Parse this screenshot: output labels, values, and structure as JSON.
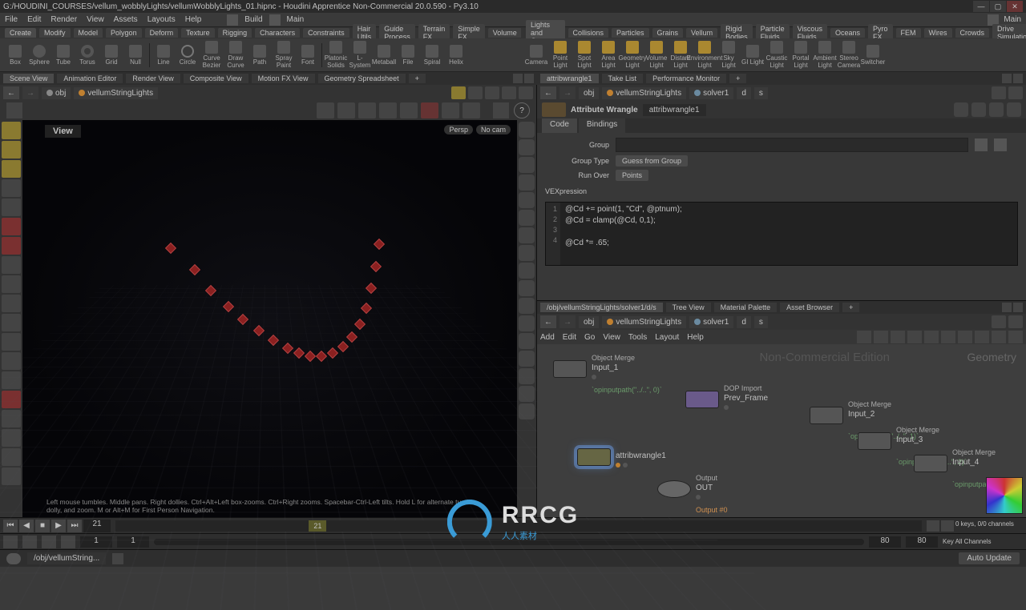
{
  "title": "G:/HOUDINI_COURSES/vellum_wobblyLights/vellumWobblyLights_01.hipnc - Houdini Apprentice Non-Commercial 20.0.590 - Py3.10",
  "menubar": [
    "File",
    "Edit",
    "Render",
    "View",
    "Assets",
    "Layouts",
    "Help"
  ],
  "config_build": "Build",
  "config_main_left": "Main",
  "config_main_right": "Main",
  "shelf": {
    "left_tab": "Create",
    "groups_left": [
      "Create",
      "Modify",
      "Model",
      "Polygon",
      "Deform",
      "Texture",
      "Rigging",
      "Characters",
      "Constraints",
      "Hair Utils",
      "Guide Process",
      "Terrain FX",
      "Simple FX",
      "Volume"
    ],
    "tools_left": [
      "Box",
      "Sphere",
      "Tube",
      "Torus",
      "Grid",
      "Null",
      "Line",
      "Circle",
      "Curve Bezier",
      "Draw Curve",
      "Path",
      "Spray Paint",
      "Font",
      "Platonic Solids",
      "L-System",
      "Metaball",
      "File",
      "Spiral",
      "Helix"
    ],
    "groups_right": [
      "Lights and Cameras",
      "Collisions",
      "Particles",
      "Grains",
      "Vellum",
      "Rigid Bodies",
      "Particle Fluids",
      "Viscous Fluids",
      "Oceans",
      "Pyro FX",
      "FEM",
      "Wires",
      "Crowds",
      "Drive Simulation"
    ],
    "tools_right": [
      "Camera",
      "Point Light",
      "Spot Light",
      "Area Light",
      "Geometry Light",
      "Volume Light",
      "Distant Light",
      "Environment Light",
      "Sky Light",
      "GI Light",
      "Caustic Light",
      "Portal Light",
      "Ambient Light",
      "Stereo Camera",
      "Switcher"
    ]
  },
  "panetabs_left": [
    "Scene View",
    "Animation Editor",
    "Render View",
    "Composite View",
    "Motion FX View",
    "Geometry Spreadsheet"
  ],
  "panetabs_right_top": [
    "attribwrangle1",
    "Take List",
    "Performance Monitor"
  ],
  "panetabs_right_bottom": [
    "/obj/vellumStringLights/solver1/d/s",
    "Tree View",
    "Material Palette",
    "Asset Browser"
  ],
  "path_left": {
    "obj": "obj",
    "geo": "vellumStringLights"
  },
  "path_right": {
    "obj": "obj",
    "geo": "vellumStringLights",
    "sop": "solver1",
    "d": "d",
    "s": "s"
  },
  "viewport": {
    "label": "View",
    "persp": "Persp",
    "cam": "No cam",
    "hint": "Left mouse tumbles. Middle pans. Right dollies. Ctrl+Alt+Left box-zooms. Ctrl+Right zooms. Spacebar-Ctrl-Left tilts. Hold L for alternate tumble, dolly, and zoom. M or Alt+M for First Person Navigation."
  },
  "parm": {
    "type": "Attribute Wrangle",
    "name": "attribwrangle1",
    "tabs": [
      "Code",
      "Bindings"
    ],
    "group_label": "Group",
    "group_value": "",
    "group_type_label": "Group Type",
    "group_type_value": "Guess from Group",
    "run_over_label": "Run Over",
    "run_over_value": "Points",
    "vex_label": "VEXpression",
    "vex_lines": [
      "@Cd += point(1, \"Cd\", @ptnum);",
      "@Cd = clamp(@Cd, 0,1);",
      "",
      "@Cd *= .65;"
    ]
  },
  "netmenu": [
    "Add",
    "Edit",
    "Go",
    "View",
    "Tools",
    "Layout",
    "Help"
  ],
  "net_watermark": "Non-Commercial Edition",
  "net_context": "Geometry",
  "nodes": {
    "input1": {
      "type": "Object Merge",
      "name": "Input_1",
      "expr": "`opinputpath(\"../..\", 0)`"
    },
    "prev": {
      "type": "DOP Import",
      "name": "Prev_Frame"
    },
    "wrangle": {
      "name": "attribwrangle1"
    },
    "out": {
      "type": "Output",
      "name": "OUT",
      "out": "Output #0"
    },
    "input2": {
      "type": "Object Merge",
      "name": "Input_2",
      "expr": "`opinputpath(\"../..\", 1)`"
    },
    "input3": {
      "type": "Object Merge",
      "name": "Input_3",
      "expr": "`opinputpath(\"../..\", 2)`"
    },
    "input4": {
      "type": "Object Merge",
      "name": "Input_4",
      "expr": "`opinputpath("
    }
  },
  "timeline": {
    "cur": "21",
    "start": "1",
    "end": "80",
    "endr": "80",
    "keys": "0 keys, 0/0 channels",
    "chans": "Key All Channels"
  },
  "status": {
    "path": "/obj/vellumString...",
    "update": "Auto Update"
  },
  "brand": {
    "name": "RRCG",
    "sub": "人人素材"
  }
}
